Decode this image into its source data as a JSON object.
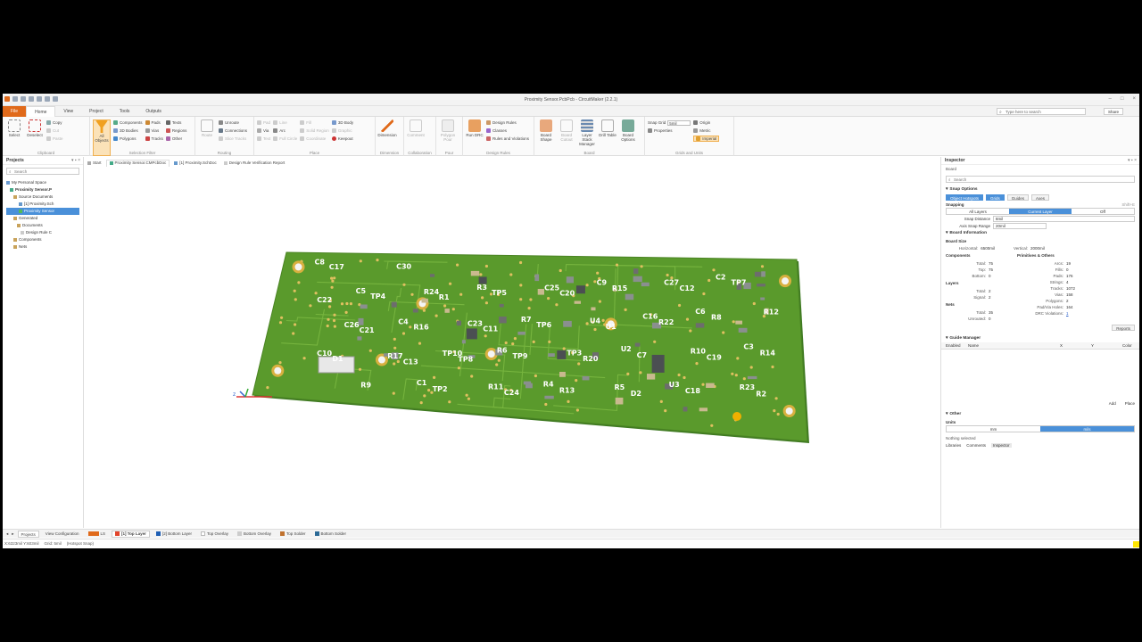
{
  "window": {
    "title": "Proximity Sensor.PcbPcb - CircuitMaker (2.2.1)"
  },
  "menu": {
    "tabs": [
      "File",
      "Home",
      "View",
      "Project",
      "Tools",
      "Outputs"
    ],
    "active": "Home",
    "search_placeholder": "Type here to search",
    "share_label": "Share"
  },
  "ribbon": {
    "clipboard": {
      "label": "Clipboard",
      "select": "Select",
      "deselect": "Deselect",
      "copy": "Copy",
      "cut": "Cut",
      "paste": "Paste"
    },
    "selection_filter": {
      "label": "Selection Filter",
      "all_objects": "All Objects",
      "components": "Components",
      "3d_bodies": "3D Bodies",
      "polygons": "Polygons",
      "pads": "Pads",
      "vias": "Vias",
      "tracks": "Tracks",
      "texts": "Texts",
      "regions": "Regions",
      "other": "Other"
    },
    "routing": {
      "label": "Routing",
      "route": "Route",
      "unroute": "Unroute",
      "connections": "Connections",
      "slice_tracks": "Slice Tracks"
    },
    "place": {
      "label": "Place",
      "pad": "Pad",
      "via": "Via",
      "text": "Text",
      "line": "Line",
      "arc": "Arc",
      "full_circle": "Full Circle",
      "fill": "Fill",
      "solid_region": "Solid Region",
      "coordinate": "Coordinate",
      "3d_body": "3D Body",
      "graphic": "Graphic",
      "keepout": "Keepout"
    },
    "dimension": {
      "label": "Dimension",
      "dimension": "Dimension"
    },
    "collaboration": {
      "label": "Collaboration",
      "comment": "Comment"
    },
    "pour": {
      "label": "Pour",
      "polygon_pour": "Polygon Pour"
    },
    "design_rules": {
      "label": "Design Rules",
      "run_drc": "Run DRC",
      "design_rules": "Design Rules",
      "classes": "Classes",
      "rules_and_violations": "Rules and Violations"
    },
    "board": {
      "label": "Board",
      "board_shape": "Board Shape",
      "board_cutout": "Board Cutout",
      "layer_stack_manager": "Layer Stack Manager",
      "drill_table": "Drill Table",
      "board_options": "Board Options"
    },
    "grids_units": {
      "label": "Grids and Units",
      "snap_grid": "Snap Grid",
      "snap_value": "5mil",
      "properties": "Properties",
      "origin": "Origin",
      "metric": "Metric",
      "imperial": "Imperial"
    }
  },
  "projects_panel": {
    "title": "Projects",
    "search": "Search",
    "tree": [
      "My Personal Space",
      "Proximity Sensor.P",
      "Source Documents",
      "[1] Proximity.Sch",
      "Proximity Sensor",
      "Generated",
      "Documents",
      "Design Rule C",
      "Components",
      "Nets"
    ]
  },
  "doc_tabs": [
    "Start",
    "Proximity Sensor.CMPcbDoc",
    "[1] Proximity.SchDoc",
    "Design Rule Verification Report"
  ],
  "pcb": {
    "labels": [
      "C8",
      "R6",
      "C6",
      "C1",
      "U2",
      "C5",
      "R4",
      "C3",
      "R3",
      "U3",
      "C4",
      "C9",
      "C10",
      "R7",
      "C2",
      "TP10",
      "C16",
      "R9",
      "TP3",
      "R12",
      "R11",
      "R10",
      "R24",
      "R5",
      "C26",
      "C25",
      "R23",
      "C23",
      "C27",
      "R17",
      "U4",
      "C17",
      "TP9",
      "R8",
      "TP2",
      "C7",
      "TP4",
      "R13",
      "R14",
      "TP5",
      "C18",
      "R16",
      "R15",
      "D1",
      "TP6",
      "TP7",
      "TP8",
      "R22",
      "C30",
      "R20",
      "C22",
      "C24",
      "C19",
      "R1",
      "D2",
      "C21",
      "C20",
      "R2",
      "C11",
      "C12",
      "C13",
      "U1"
    ]
  },
  "inspector": {
    "title": "Inspector",
    "object": "Board",
    "search": "Search",
    "snap_options": "Snap Options",
    "snap_tabs": [
      "Object Hotspots",
      "Grids",
      "Guides",
      "Axes"
    ],
    "snapping": "Snapping",
    "snapping_shortcut": "Shift+E",
    "snap_layers": [
      "All Layers",
      "Current Layer",
      "Off"
    ],
    "snap_distance_label": "Snap Distance",
    "snap_distance": "8mil",
    "axis_snap_label": "Axis Snap Range",
    "axis_snap": "20mil",
    "board_info": "Board Information",
    "board_size": "Board Size",
    "horizontal_label": "Horizontal:",
    "horizontal": "6500mil",
    "vertical_label": "Vertical:",
    "vertical": "2000mil",
    "components_label": "Components",
    "primitives_label": "Primitives & Others",
    "comp_total": "75",
    "comp_top": "75",
    "comp_bottom": "0",
    "arcs": "19",
    "fills": "0",
    "pads": "176",
    "strings": "4",
    "tracks": "1072",
    "vias": "158",
    "polygons": "2",
    "padvia_holes": "164",
    "drc_violations": "1",
    "layers_label": "Layers",
    "layers_total": "2",
    "layers_signal": "2",
    "nets_label": "Nets",
    "nets_total": "35",
    "nets_unrouted": "0",
    "reports_btn": "Reports",
    "guide_manager": "Guide Manager",
    "guide_cols": [
      "Enabled",
      "Name",
      "X",
      "Y",
      "Color"
    ],
    "add_btn": "Add",
    "place_btn": "Place",
    "other": "Other",
    "units": "Units",
    "units_opts": [
      "mm",
      "mils"
    ],
    "nothing_selected": "Nothing selected",
    "bottom_tabs": [
      "Libraries",
      "Comments",
      "Inspector"
    ]
  },
  "layers_bar": {
    "tabs": [
      "Projects",
      "View Configuration"
    ],
    "layers": [
      {
        "name": "LS",
        "color": "#e06a1b"
      },
      {
        "name": "[1] Top Layer",
        "color": "#e2452c"
      },
      {
        "name": "[2] Bottom Layer",
        "color": "#1f5fb4"
      },
      {
        "name": "Top Overlay",
        "color": "#ffffff"
      },
      {
        "name": "Bottom Overlay",
        "color": "#cccccc"
      },
      {
        "name": "Top Solder",
        "color": "#c0722e"
      },
      {
        "name": "Bottom Solder",
        "color": "#2b6a96"
      }
    ]
  },
  "status": {
    "coords": "X:6323mil Y:603mil",
    "grid": "Grid: 5mil",
    "snap": "(Hotspot Snap)"
  }
}
